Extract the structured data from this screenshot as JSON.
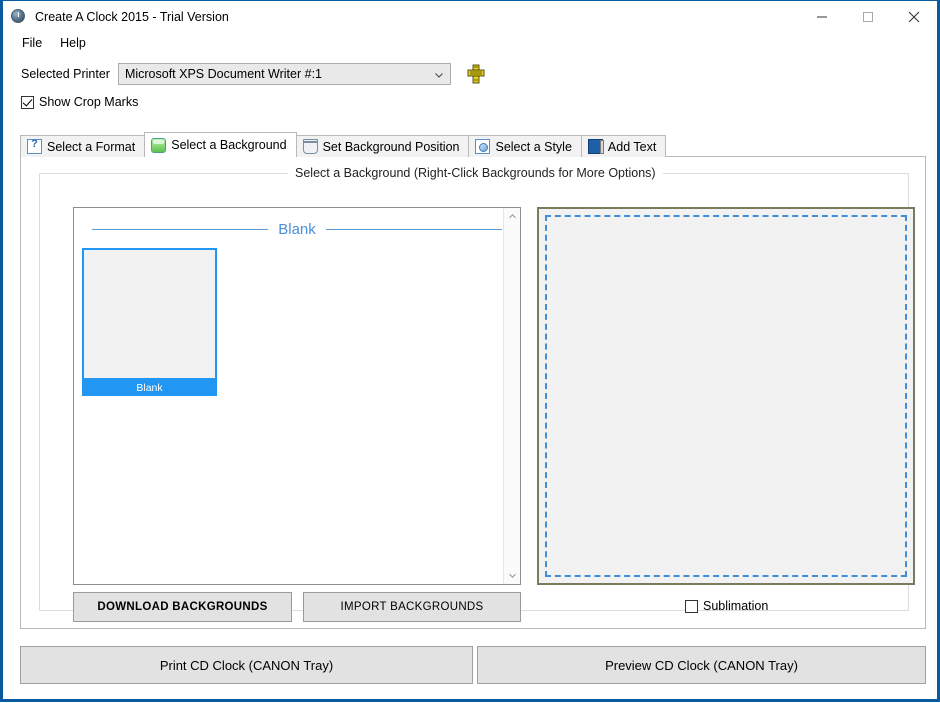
{
  "window": {
    "title": "Create A Clock 2015 - Trial Version",
    "app_icon": "clock-icon",
    "controls": {
      "minimize": "minimize-icon",
      "maximize": "maximize-icon",
      "close": "close-icon"
    }
  },
  "menubar": {
    "items": [
      {
        "label": "File"
      },
      {
        "label": "Help"
      }
    ]
  },
  "printer": {
    "label": "Selected Printer",
    "value": "Microsoft XPS Document Writer #:1",
    "placeholder": "Select a printer",
    "setup_icon": "printer-setup-icon",
    "dropdown_icon": "chevron-down-icon"
  },
  "crop_marks": {
    "label": "Show Crop Marks",
    "checked": true
  },
  "tabs": [
    {
      "label": "Select a Format",
      "icon": "format-icon",
      "active": false
    },
    {
      "label": "Select a Background",
      "icon": "background-icon",
      "active": true
    },
    {
      "label": "Set Background Position",
      "icon": "position-icon",
      "active": false
    },
    {
      "label": "Select a Style",
      "icon": "style-icon",
      "active": false
    },
    {
      "label": "Add Text",
      "icon": "add-text-icon",
      "active": false
    }
  ],
  "groupbox": {
    "title": "Select a Background (Right-Click Backgrounds for More Options)"
  },
  "background_list": {
    "category": "Blank",
    "items": [
      {
        "caption": "Blank",
        "selected": true
      }
    ],
    "scroll_up_icon": "chevron-up-icon",
    "scroll_down_icon": "chevron-down-icon"
  },
  "list_buttons": {
    "download": "DOWNLOAD BACKGROUNDS",
    "import": "IMPORT BACKGROUNDS"
  },
  "sublimation": {
    "label": "Sublimation",
    "checked": false
  },
  "actions": {
    "print": "Print CD Clock (CANON Tray)",
    "preview": "Preview CD Clock (CANON Tray)"
  },
  "colors": {
    "window_border": "#0a5aa0",
    "accent_blue": "#2196f3",
    "category_blue": "#4a90d9",
    "preview_border": "#7c7a5c",
    "preview_dash": "#3f8fd8",
    "button_face": "#e2e2e2"
  }
}
